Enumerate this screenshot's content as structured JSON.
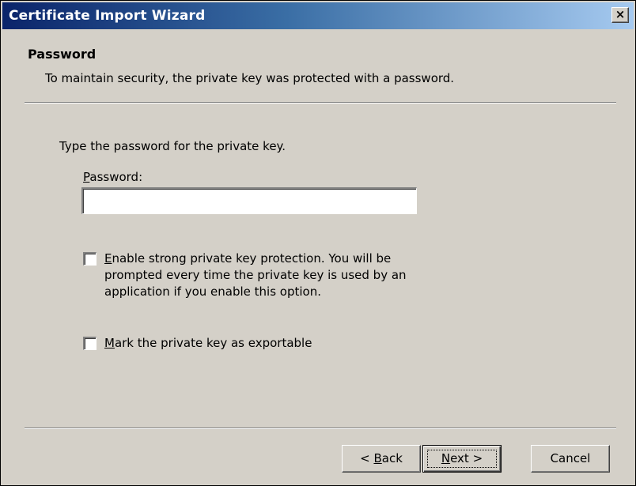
{
  "window": {
    "title": "Certificate Import Wizard",
    "close_glyph": "×",
    "titlebar_colors": [
      "#0a246a",
      "#a6caf0"
    ]
  },
  "header": {
    "title": "Password",
    "subtitle": "To maintain security, the private key was protected with a password."
  },
  "body": {
    "instruction": "Type the password for the private key.",
    "password_label_mnemonic": "P",
    "password_label_rest": "assword:",
    "password_value": "",
    "strong_protection": {
      "checked": false,
      "mnemonic": "E",
      "line1_rest": "nable strong private key protection. You will be",
      "line2": "prompted every time the private key is used by an",
      "line3": "application if you enable this option."
    },
    "exportable": {
      "checked": false,
      "mnemonic": "M",
      "rest": "ark the private key as exportable"
    }
  },
  "buttons": {
    "back_prefix": "< ",
    "back_mnemonic": "B",
    "back_rest": "ack",
    "next_mnemonic": "N",
    "next_rest": "ext >",
    "cancel": "Cancel"
  }
}
